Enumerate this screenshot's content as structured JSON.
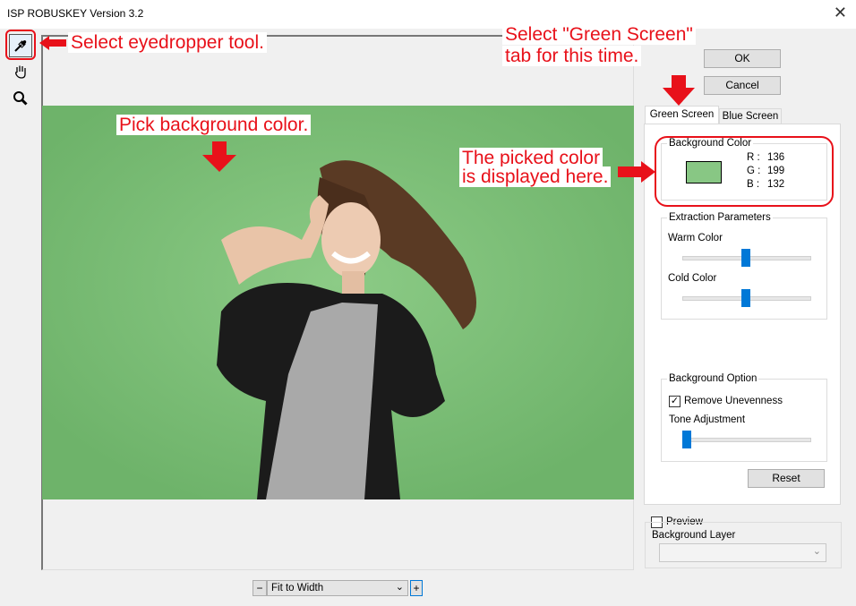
{
  "window": {
    "title": "ISP ROBUSKEY Version 3.2",
    "close_glyph": "✕"
  },
  "tools": [
    {
      "name": "eyedropper-icon"
    },
    {
      "name": "hand-icon"
    },
    {
      "name": "zoom-icon"
    }
  ],
  "buttons": {
    "ok": "OK",
    "cancel": "Cancel",
    "reset": "Reset"
  },
  "tabs": {
    "green": "Green Screen",
    "blue": "Blue Screen",
    "active": "green"
  },
  "background_color": {
    "legend": "Background Color",
    "swatch": "#88c784",
    "r_label": "R :",
    "r": "136",
    "g_label": "G :",
    "g": "199",
    "b_label": "B :",
    "b": "132"
  },
  "extraction": {
    "legend": "Extraction Parameters",
    "warm_label": "Warm Color",
    "warm_value": 0.5,
    "cold_label": "Cold Color",
    "cold_value": 0.5
  },
  "background_option": {
    "legend": "Background Option",
    "remove_unevenness_label": "Remove Unevenness",
    "remove_unevenness": true,
    "tone_label": "Tone Adjustment",
    "tone_value": 0.0
  },
  "preview": {
    "label": "Preview",
    "checked": false,
    "bg_layer_label": "Background Layer",
    "bg_layer_value": ""
  },
  "zoom": {
    "minus": "−",
    "plus": "+",
    "mode": "Fit to Width"
  },
  "annotations": {
    "eyedropper": "Select eyedropper tool.",
    "tab_line1": "Select \"Green Screen\"",
    "tab_line2": "tab for this time.",
    "pick": "Pick background color.",
    "picked_line1": "The picked color",
    "picked_line2": "is displayed here."
  },
  "colors": {
    "green_bg": "#7bbd76",
    "accent": "#0078d7",
    "annotation": "#e8111a"
  }
}
